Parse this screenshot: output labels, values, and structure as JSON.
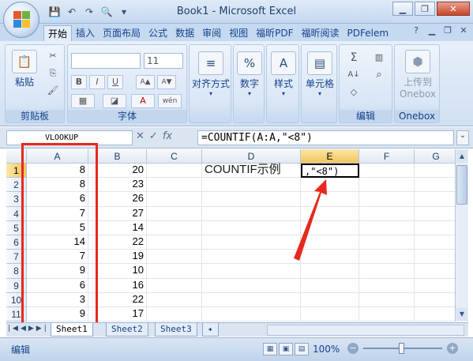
{
  "window": {
    "title": "Book1 - Microsoft Excel",
    "minimize_label": "▁",
    "restore_label": "❐",
    "close_label": "✕"
  },
  "qat": {
    "save_icon": "💾",
    "undo_icon": "↶",
    "redo_icon": "↷",
    "preview_icon": "🔍",
    "more_icon": "▾"
  },
  "tabs": [
    {
      "label": "开始",
      "active": true
    },
    {
      "label": "插入"
    },
    {
      "label": "页面布局"
    },
    {
      "label": "公式"
    },
    {
      "label": "数据"
    },
    {
      "label": "审阅"
    },
    {
      "label": "视图"
    },
    {
      "label": "福昕PDF"
    },
    {
      "label": "福昕阅读"
    },
    {
      "label": "PDFelem"
    }
  ],
  "ribbon": {
    "clipboard": {
      "paste_label": "粘贴",
      "group_label": "剪贴板"
    },
    "font": {
      "size_value": "11",
      "group_label": "字体",
      "bold": "B",
      "italic": "I",
      "underline": "U",
      "grow": "A▲",
      "shrink": "A▼",
      "wen": "wén"
    },
    "alignment": {
      "label": "对齐方式"
    },
    "number": {
      "label": "数字",
      "icon": "%"
    },
    "styles": {
      "label": "样式"
    },
    "cells": {
      "label": "单元格"
    },
    "editing": {
      "group_label": "编辑",
      "sum_icon": "Σ",
      "sort_icon": "A↓",
      "find_icon": "⌕"
    },
    "onebox": {
      "upload_line1": "上传到",
      "upload_line2": "Onebox",
      "group_label": "Onebox"
    }
  },
  "formula_bar": {
    "name_box": "VLOOKUP",
    "cancel_icon": "✕",
    "enter_icon": "✓",
    "fx_label": "fx",
    "formula": "=COUNTIF(A:A,\"<8\")"
  },
  "columns": [
    "A",
    "B",
    "C",
    "D",
    "E",
    "F",
    "G"
  ],
  "rows": [
    {
      "row": "1",
      "a": "8",
      "b": "20",
      "d": "COUNTIF示例",
      "e": ",\"<8\")"
    },
    {
      "row": "2",
      "a": "8",
      "b": "23"
    },
    {
      "row": "3",
      "a": "6",
      "b": "26"
    },
    {
      "row": "4",
      "a": "7",
      "b": "27"
    },
    {
      "row": "5",
      "a": "5",
      "b": "14"
    },
    {
      "row": "6",
      "a": "14",
      "b": "22"
    },
    {
      "row": "7",
      "a": "7",
      "b": "19"
    },
    {
      "row": "8",
      "a": "9",
      "b": "10"
    },
    {
      "row": "9",
      "a": "6",
      "b": "16"
    },
    {
      "row": "10",
      "a": "3",
      "b": "22"
    },
    {
      "row": "11",
      "a": "9",
      "b": "17"
    }
  ],
  "sheet_tabs": [
    {
      "label": "Sheet1",
      "active": true
    },
    {
      "label": "Sheet2"
    },
    {
      "label": "Sheet3"
    }
  ],
  "status": {
    "mode": "编辑",
    "zoom": "100%",
    "zoom_minus": "−",
    "zoom_plus": "+"
  },
  "colors": {
    "annotation_red": "#e8281c",
    "selected_header": "#f4c35d"
  }
}
